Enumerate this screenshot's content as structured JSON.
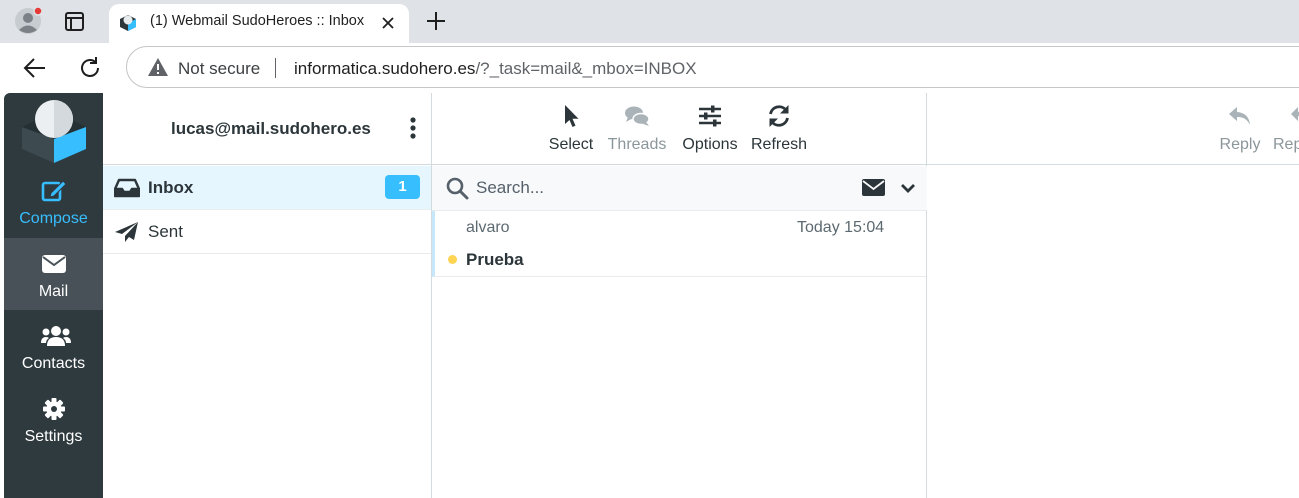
{
  "browser": {
    "tab_title": "(1) Webmail SudoHeroes :: Inbox",
    "security_label": "Not secure",
    "url_host": "informatica.sudohero.es",
    "url_path": "/?_task=mail&_mbox=INBOX"
  },
  "rail": {
    "compose_label": "Compose",
    "mail_label": "Mail",
    "contacts_label": "Contacts",
    "settings_label": "Settings"
  },
  "folders": {
    "account": "lucas@mail.sudohero.es",
    "items": [
      {
        "label": "Inbox",
        "unread": "1"
      },
      {
        "label": "Sent"
      }
    ]
  },
  "list_toolbar": {
    "select_label": "Select",
    "threads_label": "Threads",
    "options_label": "Options",
    "refresh_label": "Refresh"
  },
  "search": {
    "placeholder": "Search..."
  },
  "messages": [
    {
      "from": "alvaro",
      "date": "Today 15:04",
      "subject": "Prueba"
    }
  ],
  "preview_toolbar": {
    "reply_label": "Reply",
    "reply_all_label": "Reply all"
  },
  "colors": {
    "accent": "#37beff",
    "rail_bg": "#2f3a3f",
    "rail_active": "#475157",
    "unread_dot": "#ffd452"
  }
}
